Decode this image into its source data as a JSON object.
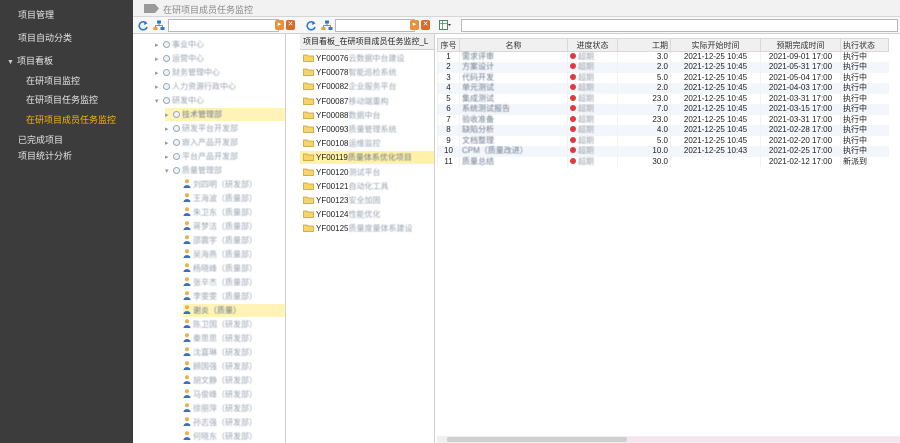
{
  "sidebar": {
    "items": [
      {
        "label": "项目管理",
        "level": 1,
        "active": false
      },
      {
        "label": "项目自动分类",
        "level": 1,
        "active": false
      },
      {
        "label": "项目看板",
        "level": 1,
        "active": false,
        "expanded": true
      },
      {
        "label": "在研项目监控",
        "level": 2,
        "active": false
      },
      {
        "label": "在研项目任务监控",
        "level": 2,
        "active": false
      },
      {
        "label": "在研项目成员任务监控",
        "level": 2,
        "active": true
      },
      {
        "label": "已完成项目",
        "level": 1,
        "active": false
      },
      {
        "label": "项目统计分析",
        "level": 1,
        "active": false
      }
    ]
  },
  "topbar": {
    "tab_label": "在研项目成员任务监控"
  },
  "tree": {
    "search": {
      "value": "",
      "placeholder": ""
    },
    "nodes": [
      {
        "label": "事业中心",
        "indent": 1,
        "type": "dept"
      },
      {
        "label": "运营中心",
        "indent": 1,
        "type": "dept"
      },
      {
        "label": "财务管理中心",
        "indent": 1,
        "type": "dept"
      },
      {
        "label": "人力资源行政中心",
        "indent": 1,
        "type": "dept"
      },
      {
        "label": "研发中心",
        "indent": 1,
        "type": "dept",
        "expanded": true
      },
      {
        "label": "技术管理部",
        "indent": 2,
        "type": "dept",
        "highlight": true
      },
      {
        "label": "研发平台开发部",
        "indent": 2,
        "type": "dept"
      },
      {
        "label": "嵌入产品开发部",
        "indent": 2,
        "type": "dept"
      },
      {
        "label": "平台产品开发部",
        "indent": 2,
        "type": "dept"
      },
      {
        "label": "质量管理部",
        "indent": 2,
        "type": "dept",
        "expanded": true
      },
      {
        "label": "刘四明（研发部）",
        "indent": 3,
        "type": "person"
      },
      {
        "label": "王海波（质量部）",
        "indent": 3,
        "type": "person"
      },
      {
        "label": "朱卫东（质量部）",
        "indent": 3,
        "type": "person"
      },
      {
        "label": "蒋梦洁（质量部）",
        "indent": 3,
        "type": "person"
      },
      {
        "label": "邵震宇（质量部）",
        "indent": 3,
        "type": "person"
      },
      {
        "label": "吴海燕（质量部）",
        "indent": 3,
        "type": "person"
      },
      {
        "label": "杨晓峰（质量部）",
        "indent": 3,
        "type": "person"
      },
      {
        "label": "张辛杰（质量部）",
        "indent": 3,
        "type": "person"
      },
      {
        "label": "李雯雯（质量部）",
        "indent": 3,
        "type": "person"
      },
      {
        "label": "谢炎（质量）",
        "indent": 3,
        "type": "person",
        "highlight": true
      },
      {
        "label": "陈卫国（研发部）",
        "indent": 3,
        "type": "person"
      },
      {
        "label": "秦思思（研发部）",
        "indent": 3,
        "type": "person"
      },
      {
        "label": "沈嘉琳（研发部）",
        "indent": 3,
        "type": "person"
      },
      {
        "label": "顾国强（研发部）",
        "indent": 3,
        "type": "person"
      },
      {
        "label": "胡文静（研发部）",
        "indent": 3,
        "type": "person"
      },
      {
        "label": "马俊峰（研发部）",
        "indent": 3,
        "type": "person"
      },
      {
        "label": "徐丽萍（研发部）",
        "indent": 3,
        "type": "person"
      },
      {
        "label": "孙志强（研发部）",
        "indent": 3,
        "type": "person"
      },
      {
        "label": "何晓东（研发部）",
        "indent": 3,
        "type": "person"
      }
    ]
  },
  "projects": {
    "header": "项目看板_在研项目成员任务监控_L",
    "items": [
      {
        "code": "YF00076",
        "name": "云数据中台建设",
        "highlight": false
      },
      {
        "code": "YF00078",
        "name": "智能巡检系统",
        "highlight": false
      },
      {
        "code": "YF00082",
        "name": "企业服务平台",
        "highlight": false
      },
      {
        "code": "YF00087",
        "name": "移动端重构",
        "highlight": false
      },
      {
        "code": "YF00088",
        "name": "数据中台",
        "highlight": false
      },
      {
        "code": "YF00093",
        "name": "质量管理系统",
        "highlight": false
      },
      {
        "code": "YF00108",
        "name": "运维监控",
        "highlight": false
      },
      {
        "code": "YF00119",
        "name": "质量体系优化项目",
        "highlight": true
      },
      {
        "code": "YF00120",
        "name": "测试平台",
        "highlight": false
      },
      {
        "code": "YF00121",
        "name": "自动化工具",
        "highlight": false
      },
      {
        "code": "YF00123",
        "name": "安全加固",
        "highlight": false
      },
      {
        "code": "YF00124",
        "name": "性能优化",
        "highlight": false
      },
      {
        "code": "YF00125",
        "name": "质量度量体系建设",
        "highlight": false
      }
    ]
  },
  "grid": {
    "columns": [
      "序号",
      "名称",
      "进度状态",
      "工期",
      "实际开始时间",
      "预期完成时间",
      "执行状态"
    ],
    "rows": [
      {
        "no": "1",
        "name": "需求评审",
        "status": "超期",
        "hours": "3.0",
        "start": "2021-12-25 10:45",
        "end": "2021-09-01 17:00",
        "exec": "执行中"
      },
      {
        "no": "2",
        "name": "方案设计",
        "status": "超期",
        "hours": "2.0",
        "start": "2021-12-25 10:45",
        "end": "2021-05-31 17:00",
        "exec": "执行中"
      },
      {
        "no": "3",
        "name": "代码开发",
        "status": "超期",
        "hours": "5.0",
        "start": "2021-12-25 10:45",
        "end": "2021-05-04 17:00",
        "exec": "执行中"
      },
      {
        "no": "4",
        "name": "单元测试",
        "status": "超期",
        "hours": "2.0",
        "start": "2021-12-25 10:45",
        "end": "2021-04-03 17:00",
        "exec": "执行中"
      },
      {
        "no": "5",
        "name": "集成测试",
        "status": "超期",
        "hours": "23.0",
        "start": "2021-12-25 10:45",
        "end": "2021-03-31 17:00",
        "exec": "执行中"
      },
      {
        "no": "6",
        "name": "系统测试报告",
        "status": "超期",
        "hours": "7.0",
        "start": "2021-12-25 10:45",
        "end": "2021-03-15 17:00",
        "exec": "执行中"
      },
      {
        "no": "7",
        "name": "验收准备",
        "status": "超期",
        "hours": "23.0",
        "start": "2021-12-25 10:45",
        "end": "2021-03-31 17:00",
        "exec": "执行中"
      },
      {
        "no": "8",
        "name": "缺陷分析",
        "status": "超期",
        "hours": "4.0",
        "start": "2021-12-25 10:45",
        "end": "2021-02-28 17:00",
        "exec": "执行中"
      },
      {
        "no": "9",
        "name": "文档整理",
        "status": "超期",
        "hours": "5.0",
        "start": "2021-12-25 10:45",
        "end": "2021-02-20 17:00",
        "exec": "执行中"
      },
      {
        "no": "10",
        "name": "CPM（质量改进）",
        "status": "超期",
        "hours": "10.0",
        "start": "2021-12-25 10:43",
        "end": "2021-02-25 17:00",
        "exec": "执行中"
      },
      {
        "no": "11",
        "name": "质量总结",
        "status": "超期",
        "hours": "30.0",
        "start": "",
        "end": "2021-02-12 17:00",
        "exec": "新派到"
      }
    ]
  },
  "colors": {
    "sidebar_bg": "#3c3c3c",
    "active": "#ffb400",
    "status_red": "#e0393b",
    "highlight": "#fff1a6"
  }
}
